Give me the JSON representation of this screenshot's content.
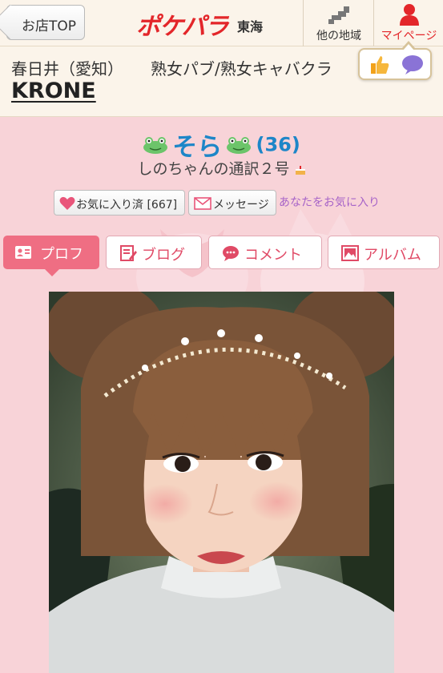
{
  "header": {
    "back_label": "お店TOP",
    "logo_brand": "ポケパラ",
    "logo_region": "東海",
    "nav_region_label": "他の地域",
    "nav_mypage_label": "マイページ"
  },
  "shop": {
    "location": "春日井（愛知）",
    "category": "熟女パブ/熟女キャバクラ",
    "name": "KRONE"
  },
  "profile": {
    "name": "そら",
    "age": "(36)",
    "catchphrase": "しのちゃんの通訳２号",
    "favorite_button": "お気に入り済 [667]",
    "message_button": "メッセージ",
    "favorited_you_link": "あなたをお気に入り"
  },
  "tabs": [
    {
      "label": "プロフ",
      "icon": "profile-card-icon",
      "active": true
    },
    {
      "label": "ブログ",
      "icon": "blog-edit-icon",
      "active": false
    },
    {
      "label": "コメント",
      "icon": "comment-bubble-icon",
      "active": false
    },
    {
      "label": "アルバム",
      "icon": "album-photo-icon",
      "active": false
    }
  ],
  "colors": {
    "brand_red": "#e3262a",
    "name_blue": "#1d86c8",
    "tab_pink": "#ef6e83",
    "background_pink": "#f8d3d8",
    "link_purple": "#a764c8"
  }
}
